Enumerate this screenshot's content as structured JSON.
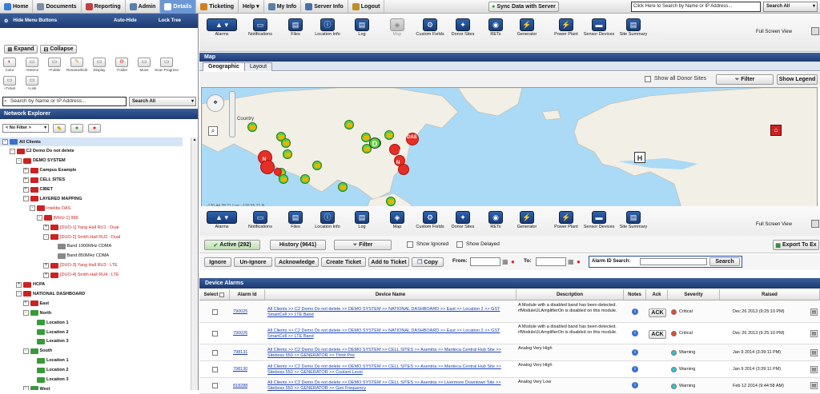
{
  "topnav": {
    "items": [
      {
        "label": "Home",
        "icon": "home-icon"
      },
      {
        "label": "Documents",
        "icon": "documents-icon"
      },
      {
        "label": "Reporting",
        "icon": "reporting-icon"
      },
      {
        "label": "Admin",
        "icon": "admin-icon"
      },
      {
        "label": "Details",
        "icon": "details-icon"
      },
      {
        "label": "Ticketing",
        "icon": "ticketing-icon"
      },
      {
        "label": "Help",
        "icon": ""
      },
      {
        "label": "My Info",
        "icon": "user-icon"
      },
      {
        "label": "Server Info",
        "icon": "server-icon"
      },
      {
        "label": "Logout",
        "icon": "logout-icon"
      }
    ],
    "sync_label": "Sync Data with Server",
    "search_placeholder": "Click Here to Search by Name or IP Address...",
    "search_scope": "Search All"
  },
  "left": {
    "hide_menu": "Hide Menu Buttons",
    "auto_hide": "Auto-Hide",
    "lock_tree": "Lock Tree",
    "expand": "Expand",
    "collapse": "Collapse",
    "tools": [
      "Color",
      "+Device",
      "+Folder",
      "Rename/Edit",
      "Display",
      "-Folder",
      "Move",
      "Scan Progress",
      "+Ticket",
      "+Link"
    ],
    "search_placeholder": "Search by Name or IP Address...",
    "search_scope": "Search All",
    "explorer_title": "Network Explorer",
    "filter_value": "< No Filter >",
    "tree": [
      {
        "label": "All Clients",
        "level": 0,
        "pm": "-",
        "color": "#3a6fd0"
      },
      {
        "label": "C2 Demo Do not delete",
        "level": 1,
        "pm": "-",
        "color": "#cc2222"
      },
      {
        "label": "DEMO SYSTEM",
        "level": 2,
        "pm": "-",
        "color": "#cc2222"
      },
      {
        "label": "Campus Example",
        "level": 3,
        "pm": "+",
        "color": "#cc2222"
      },
      {
        "label": "CELL SITES",
        "level": 3,
        "pm": "+",
        "color": "#cc2222"
      },
      {
        "label": "CIBET",
        "level": 3,
        "pm": "+",
        "color": "#cc2222"
      },
      {
        "label": "LAYERED MAPPING",
        "level": 3,
        "pm": "-",
        "color": "#cc2222"
      },
      {
        "label": "Intelibs DAS",
        "level": 4,
        "pm": "-",
        "color": "#cc2222"
      },
      {
        "label": "[MHU-1] 999",
        "level": 5,
        "pm": "-",
        "color": "#cc2222"
      },
      {
        "label": "[DUO-1] Yang Hall RU1 : Dual",
        "level": 6,
        "pm": "+",
        "color": "#cc2222"
      },
      {
        "label": "[DUO-2] Smith Hall RU2 : Dual",
        "level": 6,
        "pm": "-",
        "color": "#cc2222"
      },
      {
        "label": "Band 1900MHz CDMA",
        "level": 7,
        "pm": "",
        "color": "#888888"
      },
      {
        "label": "Band 850MHz CDMA",
        "level": 7,
        "pm": "",
        "color": "#888888"
      },
      {
        "label": "[DUO-3] Yang Hall RU3 : LTE",
        "level": 6,
        "pm": "+",
        "color": "#cc2222"
      },
      {
        "label": "[DUO-4] Smith Hall RU4 : LTE",
        "level": 6,
        "pm": "+",
        "color": "#cc2222"
      },
      {
        "label": "HCPA",
        "level": 2,
        "pm": "+",
        "color": "#cc2222"
      },
      {
        "label": "NATIONAL DASHBOARD",
        "level": 2,
        "pm": "-",
        "color": "#cc2222"
      },
      {
        "label": "East",
        "level": 3,
        "pm": "+",
        "color": "#cc2222"
      },
      {
        "label": "North",
        "level": 3,
        "pm": "-",
        "color": "#3a9a3a"
      },
      {
        "label": "Location 1",
        "level": 4,
        "pm": "",
        "color": "#3a9a3a"
      },
      {
        "label": "Location 2",
        "level": 4,
        "pm": "",
        "color": "#3a9a3a"
      },
      {
        "label": "Location 3",
        "level": 4,
        "pm": "",
        "color": "#3a9a3a"
      },
      {
        "label": "South",
        "level": 3,
        "pm": "-",
        "color": "#3a9a3a"
      },
      {
        "label": "Location 1",
        "level": 4,
        "pm": "",
        "color": "#3a9a3a"
      },
      {
        "label": "Location 2",
        "level": 4,
        "pm": "",
        "color": "#3a9a3a"
      },
      {
        "label": "Location 3",
        "level": 4,
        "pm": "",
        "color": "#3a9a3a"
      },
      {
        "label": "West",
        "level": 3,
        "pm": "-",
        "color": "#3a9a3a"
      }
    ]
  },
  "ribbon": {
    "items": [
      "Alarms",
      "Notifications",
      "Files",
      "Location Info",
      "Log",
      "Map",
      "Custom Fields",
      "Donor Sites",
      "RETs",
      "Generator",
      "Power Plant",
      "Sensor Devices",
      "Site Summary"
    ],
    "fullscreen": "Full Screen View"
  },
  "map": {
    "title": "Map",
    "tabs": [
      "Geographic",
      "Layout"
    ],
    "show_donor": "Show all Donor Sites",
    "filter": "Filter",
    "show_legend": "Show Legend",
    "country_label": "Country",
    "marker_labels": [
      "D",
      "N",
      "DAS",
      "AS",
      "N",
      "H"
    ],
    "coords_text": "-120.44 28.71 Lon: -120.55.21 N"
  },
  "alarms": {
    "active": "Active (292)",
    "history": "History (9641)",
    "filter": "Filter",
    "show_ignored": "Show Ignored",
    "show_delayed": "Show Delayed",
    "export": "Export To Ex",
    "actions": [
      "Ignore",
      "Un-Ignore",
      "Acknowledge",
      "Create Ticket",
      "Add to Ticket",
      "Copy"
    ],
    "from_label": "From:",
    "to_label": "To:",
    "alarm_id_label": "Alarm ID Search:",
    "search": "Search",
    "title": "Device Alarms",
    "columns": [
      "Select",
      "Alarm Id",
      "Device Name",
      "Description",
      "Notes",
      "Ack",
      "Severity",
      "Raised"
    ],
    "rows": [
      {
        "id": "790025",
        "device": "All Clients >> C2 Demo Do not delete >> DEMO SYSTEM >> NATIONAL DASHBOARD >> East >> Location 2 >> GST SmartCell >> LTE Band",
        "desc": "A Module with a disabled band has been detected. rfModuleULAmplifierOn is disabled on this module.",
        "ack": "ACK",
        "severity": "Critical",
        "sevcolor": "#e24b2c",
        "raised": "Dec 26 2013 (9:25:10 PM)"
      },
      {
        "id": "790026",
        "device": "All Clients >> C2 Demo Do not delete >> DEMO SYSTEM >> NATIONAL DASHBOARD >> East >> Location 2 >> GST SmartCell >> LTE Band",
        "desc": "A Module with a disabled band has been detected. rfModuleULAmplifierOn is disabled on this module.",
        "ack": "ACK",
        "severity": "Critical",
        "sevcolor": "#e24b2c",
        "raised": "Dec 26 2013 (9:25:10 PM)"
      },
      {
        "id": "798131",
        "device": "All Clients >> C2 Demo Do not delete >> DEMO SYSTEM >> CELL SITES >> Asentria >> Manteca Central Hub Site >> Siteboss 550 >> GENERATOR >> Throt Pos",
        "desc": "Analog Very High",
        "ack": "",
        "severity": "Warning",
        "sevcolor": "#35c0d8",
        "raised": "Jan 9 2014 (3:39:11 PM)"
      },
      {
        "id": "798130",
        "device": "All Clients >> C2 Demo Do not delete >> DEMO SYSTEM >> CELL SITES >> Asentria >> Manteca Central Hub Site >> Siteboss 550 >> GENERATOR >> Coolant Level",
        "desc": "Analog Very High",
        "ack": "",
        "severity": "Warning",
        "sevcolor": "#35c0d8",
        "raised": "Jan 9 2014 (3:39:11 PM)"
      },
      {
        "id": "818288",
        "device": "All Clients >> C2 Demo Do not delete >> DEMO SYSTEM >> CELL SITES >> Asentria >> Livermore Downtown Site >> Siteboss 550 >> GENERATOR >> Gen Frequency",
        "desc": "Analog Very Low",
        "ack": "",
        "severity": "Warning",
        "sevcolor": "#35c0d8",
        "raised": "Feb 12 2014 (9:44:58 AM)"
      }
    ]
  }
}
